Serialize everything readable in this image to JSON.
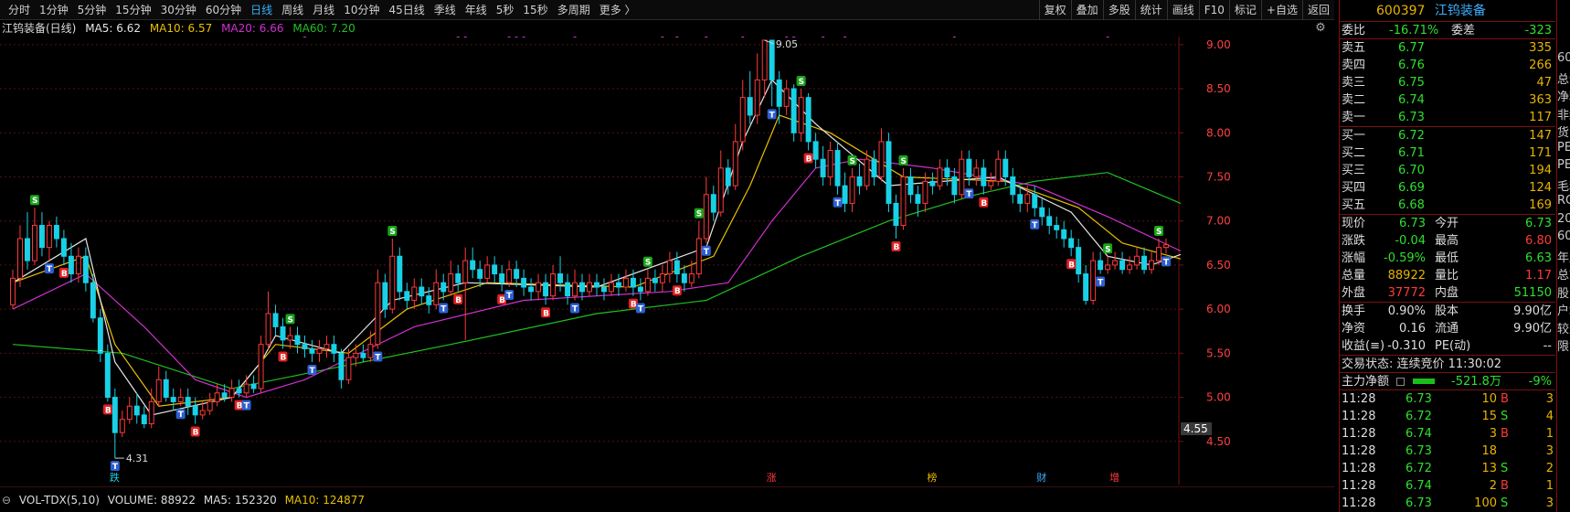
{
  "toolbar": {
    "periods": [
      "分时",
      "1分钟",
      "5分钟",
      "15分钟",
      "30分钟",
      "60分钟",
      "日线",
      "周线",
      "月线",
      "10分钟",
      "45日线",
      "季线",
      "年线",
      "5秒",
      "15秒",
      "多周期",
      "更多 〉"
    ],
    "active_period": "日线",
    "tools": [
      "复权",
      "叠加",
      "多股",
      "统计",
      "画线",
      "F10",
      "标记",
      "+自选",
      "返回"
    ]
  },
  "legend": {
    "stock_label": "江钨装备(日线)",
    "ma5": "MA5: 6.62",
    "ma10": "MA10: 6.57",
    "ma20": "MA20: 6.66",
    "ma60": "MA60: 7.20"
  },
  "colors": {
    "up": "#ff3a3a",
    "down": "#19d1e6",
    "ma5": "#e6e6e6",
    "ma10": "#e8c000",
    "ma20": "#d030d0",
    "ma60": "#20c020",
    "marker_s": "#19a519",
    "marker_b": "#e02020",
    "marker_t": "#2d5fd0"
  },
  "chart_data": {
    "type": "candlestick",
    "title": "江钨装备(日线)",
    "ylim": [
      4.5,
      9.0
    ],
    "y_ticks": [
      "9.00",
      "8.50",
      "8.00",
      "7.50",
      "7.00",
      "6.50",
      "6.00",
      "5.50",
      "5.00",
      "4.50"
    ],
    "high_label": "9.05",
    "low_label": "4.31",
    "left_dash_label": "-",
    "current_price_tag": "4.55",
    "bottom_markers": [
      "跌",
      "涨",
      "榜",
      "财",
      "增"
    ],
    "candles": [
      [
        6.05,
        6.35,
        6.45,
        6.0
      ],
      [
        6.35,
        6.8,
        6.95,
        6.25
      ],
      [
        6.8,
        6.55,
        7.1,
        6.45
      ],
      [
        6.55,
        6.95,
        7.15,
        6.5
      ],
      [
        6.95,
        6.7,
        7.1,
        6.6
      ],
      [
        6.7,
        6.95,
        7.0,
        6.55
      ],
      [
        6.95,
        6.8,
        7.05,
        6.7
      ],
      [
        6.8,
        6.6,
        6.9,
        6.5
      ],
      [
        6.6,
        6.4,
        6.75,
        6.3
      ],
      [
        6.4,
        6.6,
        6.7,
        6.3
      ],
      [
        6.6,
        6.3,
        6.7,
        6.2
      ],
      [
        6.3,
        5.9,
        6.4,
        5.85
      ],
      [
        5.9,
        5.5,
        6.0,
        5.4
      ],
      [
        5.5,
        5.0,
        5.6,
        4.95
      ],
      [
        5.0,
        4.6,
        5.1,
        4.31
      ],
      [
        4.6,
        4.75,
        4.85,
        4.55
      ],
      [
        4.75,
        4.9,
        5.0,
        4.7
      ],
      [
        4.9,
        4.8,
        5.05,
        4.7
      ],
      [
        4.8,
        4.7,
        4.9,
        4.65
      ],
      [
        4.7,
        4.95,
        5.1,
        4.65
      ],
      [
        4.95,
        5.2,
        5.35,
        4.9
      ],
      [
        5.2,
        5.0,
        5.3,
        4.95
      ],
      [
        5.0,
        4.95,
        5.1,
        4.85
      ],
      [
        4.95,
        5.0,
        5.1,
        4.9
      ],
      [
        5.0,
        4.9,
        5.1,
        4.8
      ],
      [
        4.9,
        4.8,
        5.0,
        4.7
      ],
      [
        4.8,
        4.85,
        4.95,
        4.75
      ],
      [
        4.85,
        4.95,
        5.05,
        4.8
      ],
      [
        4.95,
        5.05,
        5.15,
        4.9
      ],
      [
        5.05,
        5.0,
        5.15,
        4.95
      ],
      [
        5.0,
        5.1,
        5.2,
        4.95
      ],
      [
        5.1,
        5.05,
        5.2,
        5.0
      ],
      [
        5.05,
        5.15,
        5.25,
        5.0
      ],
      [
        5.15,
        5.1,
        5.25,
        5.05
      ],
      [
        5.1,
        5.6,
        5.7,
        5.05
      ],
      [
        5.6,
        5.95,
        6.2,
        5.55
      ],
      [
        5.95,
        5.8,
        6.05,
        5.7
      ],
      [
        5.8,
        5.65,
        5.9,
        5.55
      ],
      [
        5.65,
        5.7,
        5.8,
        5.55
      ],
      [
        5.7,
        5.6,
        5.8,
        5.5
      ],
      [
        5.6,
        5.55,
        5.7,
        5.45
      ],
      [
        5.55,
        5.5,
        5.65,
        5.4
      ],
      [
        5.5,
        5.55,
        5.65,
        5.4
      ],
      [
        5.55,
        5.6,
        5.7,
        5.45
      ],
      [
        5.6,
        5.5,
        5.7,
        5.4
      ],
      [
        5.5,
        5.2,
        5.55,
        5.1
      ],
      [
        5.2,
        5.45,
        5.55,
        5.15
      ],
      [
        5.45,
        5.5,
        5.6,
        5.35
      ],
      [
        5.5,
        5.45,
        5.6,
        5.4
      ],
      [
        5.45,
        5.6,
        5.75,
        5.4
      ],
      [
        5.6,
        6.3,
        6.45,
        5.55
      ],
      [
        6.3,
        6.0,
        6.4,
        5.9
      ],
      [
        6.0,
        6.6,
        6.8,
        5.95
      ],
      [
        6.6,
        6.2,
        6.7,
        6.1
      ],
      [
        6.2,
        6.1,
        6.3,
        6.0
      ],
      [
        6.1,
        6.25,
        6.35,
        6.0
      ],
      [
        6.25,
        6.15,
        6.35,
        6.05
      ],
      [
        6.15,
        6.05,
        6.25,
        5.95
      ],
      [
        6.05,
        6.3,
        6.45,
        6.0
      ],
      [
        6.3,
        6.2,
        6.4,
        6.1
      ],
      [
        6.2,
        6.4,
        6.55,
        6.15
      ],
      [
        6.4,
        6.3,
        6.5,
        6.2
      ],
      [
        6.3,
        6.55,
        6.7,
        5.65
      ],
      [
        6.55,
        6.45,
        6.7,
        6.35
      ],
      [
        6.45,
        6.35,
        6.55,
        6.25
      ],
      [
        6.35,
        6.5,
        6.6,
        6.3
      ],
      [
        6.5,
        6.4,
        6.6,
        6.3
      ],
      [
        6.4,
        6.3,
        6.5,
        6.2
      ],
      [
        6.3,
        6.45,
        6.55,
        6.25
      ],
      [
        6.45,
        6.35,
        6.55,
        6.25
      ],
      [
        6.35,
        6.25,
        6.45,
        6.15
      ],
      [
        6.25,
        6.2,
        6.35,
        6.1
      ],
      [
        6.2,
        6.3,
        6.4,
        6.1
      ],
      [
        6.3,
        6.15,
        6.4,
        6.05
      ],
      [
        6.15,
        6.4,
        6.5,
        6.1
      ],
      [
        6.4,
        6.3,
        6.6,
        6.2
      ],
      [
        6.3,
        6.15,
        6.4,
        6.05
      ],
      [
        6.15,
        6.3,
        6.45,
        6.1
      ],
      [
        6.3,
        6.2,
        6.4,
        6.1
      ],
      [
        6.2,
        6.3,
        6.4,
        6.15
      ],
      [
        6.3,
        6.25,
        6.4,
        6.15
      ],
      [
        6.25,
        6.2,
        6.35,
        6.1
      ],
      [
        6.2,
        6.3,
        6.4,
        6.15
      ],
      [
        6.3,
        6.25,
        6.4,
        6.15
      ],
      [
        6.25,
        6.35,
        6.45,
        6.2
      ],
      [
        6.35,
        6.25,
        6.45,
        6.15
      ],
      [
        6.25,
        6.2,
        6.35,
        6.1
      ],
      [
        6.2,
        6.35,
        6.45,
        6.15
      ],
      [
        6.35,
        6.3,
        6.45,
        6.2
      ],
      [
        6.3,
        6.4,
        6.5,
        6.2
      ],
      [
        6.4,
        6.55,
        6.65,
        6.3
      ],
      [
        6.55,
        6.4,
        6.65,
        6.3
      ],
      [
        6.4,
        6.3,
        6.5,
        6.2
      ],
      [
        6.3,
        6.4,
        6.55,
        6.25
      ],
      [
        6.4,
        6.8,
        7.0,
        6.35
      ],
      [
        6.8,
        7.3,
        7.5,
        6.75
      ],
      [
        7.3,
        7.1,
        7.4,
        7.0
      ],
      [
        7.1,
        7.6,
        7.8,
        7.05
      ],
      [
        7.6,
        7.4,
        7.7,
        7.3
      ],
      [
        7.4,
        7.9,
        8.1,
        7.35
      ],
      [
        7.9,
        8.4,
        8.6,
        7.8
      ],
      [
        8.4,
        8.2,
        8.7,
        8.1
      ],
      [
        8.2,
        8.6,
        8.9,
        8.1
      ],
      [
        8.6,
        9.05,
        9.05,
        8.4
      ],
      [
        9.05,
        8.6,
        9.05,
        8.3
      ],
      [
        8.6,
        8.3,
        8.7,
        8.1
      ],
      [
        8.3,
        8.5,
        8.6,
        8.2
      ],
      [
        8.5,
        8.0,
        8.55,
        7.9
      ],
      [
        8.0,
        8.4,
        8.5,
        7.9
      ],
      [
        8.4,
        7.9,
        8.45,
        7.8
      ],
      [
        7.9,
        7.7,
        8.0,
        7.6
      ],
      [
        7.7,
        7.5,
        7.85,
        7.4
      ],
      [
        7.5,
        7.8,
        7.9,
        7.4
      ],
      [
        7.8,
        7.4,
        7.9,
        7.3
      ],
      [
        7.4,
        7.2,
        7.55,
        7.1
      ],
      [
        7.2,
        7.5,
        7.6,
        7.1
      ],
      [
        7.5,
        7.4,
        7.65,
        7.3
      ],
      [
        7.4,
        7.7,
        7.8,
        7.35
      ],
      [
        7.7,
        7.5,
        7.8,
        7.4
      ],
      [
        7.5,
        7.9,
        8.05,
        7.45
      ],
      [
        7.9,
        7.2,
        8.0,
        7.1
      ],
      [
        7.2,
        6.95,
        7.3,
        6.8
      ],
      [
        6.95,
        7.5,
        7.6,
        6.9
      ],
      [
        7.5,
        7.3,
        7.6,
        7.2
      ],
      [
        7.3,
        7.2,
        7.4,
        7.05
      ],
      [
        7.2,
        7.45,
        7.55,
        7.1
      ],
      [
        7.45,
        7.4,
        7.55,
        7.3
      ],
      [
        7.4,
        7.6,
        7.7,
        7.35
      ],
      [
        7.6,
        7.5,
        7.7,
        7.4
      ],
      [
        7.5,
        7.3,
        7.6,
        7.2
      ],
      [
        7.3,
        7.7,
        7.8,
        7.25
      ],
      [
        7.7,
        7.5,
        7.8,
        7.4
      ],
      [
        7.5,
        7.6,
        7.7,
        7.4
      ],
      [
        7.6,
        7.4,
        7.7,
        7.3
      ],
      [
        7.4,
        7.45,
        7.55,
        7.35
      ],
      [
        7.45,
        7.7,
        7.8,
        7.4
      ],
      [
        7.7,
        7.5,
        7.8,
        7.4
      ],
      [
        7.5,
        7.3,
        7.6,
        7.2
      ],
      [
        7.3,
        7.2,
        7.4,
        7.1
      ],
      [
        7.2,
        7.3,
        7.4,
        7.1
      ],
      [
        7.3,
        7.15,
        7.4,
        7.05
      ],
      [
        7.15,
        7.05,
        7.25,
        6.95
      ],
      [
        7.05,
        6.95,
        7.15,
        6.85
      ],
      [
        6.95,
        6.9,
        7.05,
        6.8
      ],
      [
        6.9,
        6.8,
        7.0,
        6.7
      ],
      [
        6.8,
        6.7,
        6.9,
        6.6
      ],
      [
        6.7,
        6.4,
        6.8,
        6.3
      ],
      [
        6.4,
        6.1,
        6.5,
        6.05
      ],
      [
        6.1,
        6.55,
        6.65,
        6.05
      ],
      [
        6.55,
        6.45,
        6.65,
        6.4
      ],
      [
        6.45,
        6.5,
        6.6,
        6.4
      ],
      [
        6.5,
        6.55,
        6.65,
        6.45
      ],
      [
        6.55,
        6.45,
        6.65,
        6.4
      ],
      [
        6.45,
        6.5,
        6.6,
        6.4
      ],
      [
        6.5,
        6.6,
        6.7,
        6.45
      ],
      [
        6.6,
        6.45,
        6.7,
        6.4
      ],
      [
        6.45,
        6.55,
        6.65,
        6.4
      ],
      [
        6.55,
        6.7,
        6.8,
        6.5
      ],
      [
        6.7,
        6.73,
        6.8,
        6.63
      ]
    ],
    "ma5": [
      [
        0,
        6.3
      ],
      [
        10,
        6.8
      ],
      [
        14,
        5.4
      ],
      [
        19,
        4.8
      ],
      [
        30,
        5.0
      ],
      [
        34,
        5.4
      ],
      [
        36,
        5.7
      ],
      [
        45,
        5.5
      ],
      [
        52,
        6.1
      ],
      [
        62,
        6.3
      ],
      [
        80,
        6.25
      ],
      [
        95,
        6.7
      ],
      [
        100,
        7.9
      ],
      [
        104,
        8.6
      ],
      [
        110,
        8.1
      ],
      [
        120,
        7.4
      ],
      [
        135,
        7.5
      ],
      [
        145,
        7.1
      ],
      [
        150,
        6.6
      ],
      [
        156,
        6.5
      ],
      [
        160,
        6.62
      ]
    ],
    "ma10": [
      [
        0,
        6.3
      ],
      [
        10,
        6.6
      ],
      [
        14,
        5.6
      ],
      [
        20,
        4.9
      ],
      [
        30,
        5.0
      ],
      [
        36,
        5.6
      ],
      [
        46,
        5.5
      ],
      [
        54,
        6.0
      ],
      [
        65,
        6.3
      ],
      [
        85,
        6.25
      ],
      [
        96,
        6.6
      ],
      [
        101,
        7.4
      ],
      [
        105,
        8.2
      ],
      [
        112,
        8.0
      ],
      [
        122,
        7.5
      ],
      [
        136,
        7.45
      ],
      [
        146,
        7.15
      ],
      [
        152,
        6.75
      ],
      [
        160,
        6.57
      ]
    ],
    "ma20": [
      [
        0,
        6.0
      ],
      [
        10,
        6.4
      ],
      [
        18,
        5.8
      ],
      [
        25,
        5.2
      ],
      [
        32,
        5.0
      ],
      [
        40,
        5.2
      ],
      [
        55,
        5.8
      ],
      [
        70,
        6.1
      ],
      [
        90,
        6.2
      ],
      [
        98,
        6.3
      ],
      [
        104,
        7.0
      ],
      [
        110,
        7.6
      ],
      [
        116,
        7.7
      ],
      [
        126,
        7.6
      ],
      [
        140,
        7.4
      ],
      [
        150,
        7.05
      ],
      [
        160,
        6.66
      ]
    ],
    "ma60": [
      [
        0,
        5.6
      ],
      [
        15,
        5.5
      ],
      [
        30,
        5.1
      ],
      [
        45,
        5.35
      ],
      [
        60,
        5.6
      ],
      [
        80,
        5.95
      ],
      [
        95,
        6.1
      ],
      [
        108,
        6.6
      ],
      [
        120,
        7.0
      ],
      [
        132,
        7.3
      ],
      [
        140,
        7.45
      ],
      [
        150,
        7.55
      ],
      [
        160,
        7.2
      ]
    ]
  },
  "volume": {
    "label": "VOL-TDX(5,10)",
    "volume": "VOLUME: 88922",
    "ma5": "MA5: 152320",
    "ma10": "MA10: 124877"
  },
  "quote": {
    "code": "600397",
    "name": "江钨装备",
    "ratio_label": "委比",
    "ratio_value": "-16.71%",
    "diff_label": "委差",
    "diff_value": "-323",
    "asks": [
      {
        "label": "卖五",
        "price": "6.77",
        "vol": "335"
      },
      {
        "label": "卖四",
        "price": "6.76",
        "vol": "266"
      },
      {
        "label": "卖三",
        "price": "6.75",
        "vol": "47"
      },
      {
        "label": "卖二",
        "price": "6.74",
        "vol": "363"
      },
      {
        "label": "卖一",
        "price": "6.73",
        "vol": "117"
      }
    ],
    "bids": [
      {
        "label": "买一",
        "price": "6.72",
        "vol": "147"
      },
      {
        "label": "买二",
        "price": "6.71",
        "vol": "171"
      },
      {
        "label": "买三",
        "price": "6.70",
        "vol": "194"
      },
      {
        "label": "买四",
        "price": "6.69",
        "vol": "124"
      },
      {
        "label": "买五",
        "price": "6.68",
        "vol": "169"
      }
    ],
    "stats": [
      {
        "l1": "现价",
        "v1": "6.73",
        "c1": "green",
        "l2": "今开",
        "v2": "6.73",
        "c2": "green"
      },
      {
        "l1": "涨跌",
        "v1": "-0.04",
        "c1": "green",
        "l2": "最高",
        "v2": "6.80",
        "c2": "red"
      },
      {
        "l1": "涨幅",
        "v1": "-0.59%",
        "c1": "green",
        "l2": "最低",
        "v2": "6.63",
        "c2": "green"
      },
      {
        "l1": "总量",
        "v1": "88922",
        "c1": "yellow",
        "l2": "量比",
        "v2": "1.17",
        "c2": "red"
      },
      {
        "l1": "外盘",
        "v1": "37772",
        "c1": "red",
        "l2": "内盘",
        "v2": "51150",
        "c2": "green"
      }
    ],
    "stats2": [
      {
        "l1": "换手",
        "v1": "0.90%",
        "l2": "股本",
        "v2": "9.90亿"
      },
      {
        "l1": "净资",
        "v1": "0.16",
        "l2": "流通",
        "v2": "9.90亿"
      },
      {
        "l1": "收益(≡)",
        "v1": "-0.310",
        "l2": "PE(动)",
        "v2": "--"
      }
    ],
    "trade_status": "交易状态: 连续竞价 11:30:02",
    "main_flow_label": "主力净额",
    "main_flow_value": "-521.8万",
    "main_flow_pct": "-9%",
    "ticks": [
      {
        "time": "11:28",
        "price": "6.73",
        "pc": "green",
        "vol": "10",
        "side": "B",
        "sc": "red",
        "n": "3"
      },
      {
        "time": "11:28",
        "price": "6.72",
        "pc": "green",
        "vol": "15",
        "side": "S",
        "sc": "green",
        "n": "4"
      },
      {
        "time": "11:28",
        "price": "6.74",
        "pc": "green",
        "vol": "3",
        "side": "B",
        "sc": "red",
        "n": "1"
      },
      {
        "time": "11:28",
        "price": "6.73",
        "pc": "green",
        "vol": "18",
        "side": "",
        "sc": "green",
        "n": "3"
      },
      {
        "time": "11:28",
        "price": "6.72",
        "pc": "green",
        "vol": "13",
        "side": "S",
        "sc": "green",
        "n": "2"
      },
      {
        "time": "11:28",
        "price": "6.74",
        "pc": "green",
        "vol": "2",
        "side": "B",
        "sc": "red",
        "n": "1"
      },
      {
        "time": "11:28",
        "price": "6.73",
        "pc": "green",
        "vol": "100",
        "side": "S",
        "sc": "green",
        "n": "3"
      }
    ]
  },
  "edge": [
    "60",
    "总计",
    "净利",
    "非经",
    "货币",
    "PE",
    "PE(",
    "毛利",
    "RO",
    "20",
    "60",
    "年度",
    "总市",
    "股东",
    "户均",
    "较上",
    "限售"
  ]
}
